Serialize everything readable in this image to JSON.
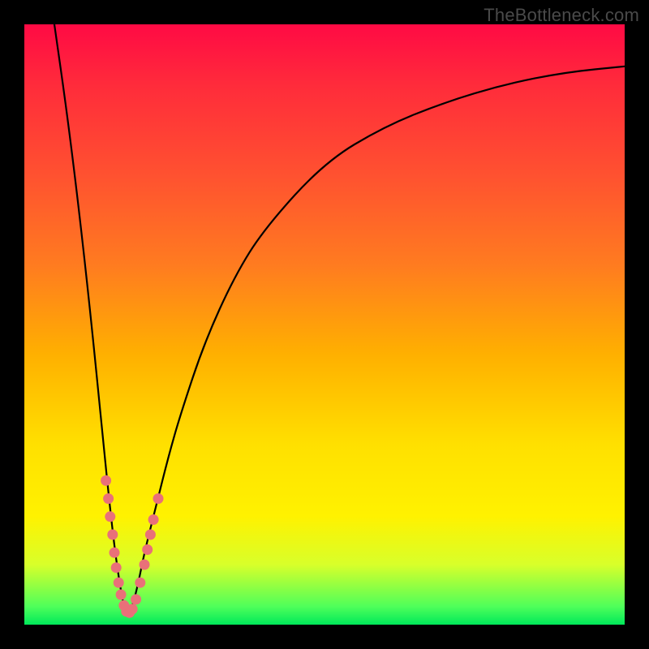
{
  "watermark": "TheBottleneck.com",
  "colors": {
    "frame": "#000000",
    "gradient_top": "#ff0a44",
    "gradient_bottom": "#00e85a",
    "curve": "#000000",
    "dot": "#e97079"
  },
  "chart_data": {
    "type": "line",
    "title": "",
    "xlabel": "",
    "ylabel": "",
    "x_range_percent": [
      0,
      100
    ],
    "y_range_percent": [
      0,
      100
    ],
    "note": "Axes are unlabeled; x and y expressed as percent of plot width/height. y=0 is bottom (green), y=100 is top (red). Single V-shaped curve with minimum near x≈17%.",
    "series": [
      {
        "name": "curve",
        "x": [
          5,
          7,
          9,
          11,
          13,
          14,
          15,
          16,
          17,
          18,
          19,
          20,
          22,
          24,
          26,
          30,
          35,
          40,
          50,
          60,
          70,
          80,
          90,
          100
        ],
        "y": [
          100,
          86,
          70,
          52,
          32,
          22,
          13,
          6,
          1,
          3,
          7,
          12,
          20,
          28,
          35,
          47,
          58,
          66,
          77,
          83,
          87,
          90,
          92,
          93
        ]
      }
    ],
    "dots_percent": [
      {
        "x": 13.6,
        "y": 24
      },
      {
        "x": 14.0,
        "y": 21
      },
      {
        "x": 14.3,
        "y": 18
      },
      {
        "x": 14.7,
        "y": 15
      },
      {
        "x": 15.0,
        "y": 12
      },
      {
        "x": 15.3,
        "y": 9.5
      },
      {
        "x": 15.7,
        "y": 7
      },
      {
        "x": 16.1,
        "y": 5
      },
      {
        "x": 16.6,
        "y": 3.2
      },
      {
        "x": 17.0,
        "y": 2.2
      },
      {
        "x": 17.5,
        "y": 2.0
      },
      {
        "x": 18.0,
        "y": 2.6
      },
      {
        "x": 18.6,
        "y": 4.2
      },
      {
        "x": 19.3,
        "y": 7
      },
      {
        "x": 20.0,
        "y": 10
      },
      {
        "x": 20.5,
        "y": 12.5
      },
      {
        "x": 21.0,
        "y": 15
      },
      {
        "x": 21.5,
        "y": 17.5
      },
      {
        "x": 22.3,
        "y": 21
      }
    ]
  }
}
